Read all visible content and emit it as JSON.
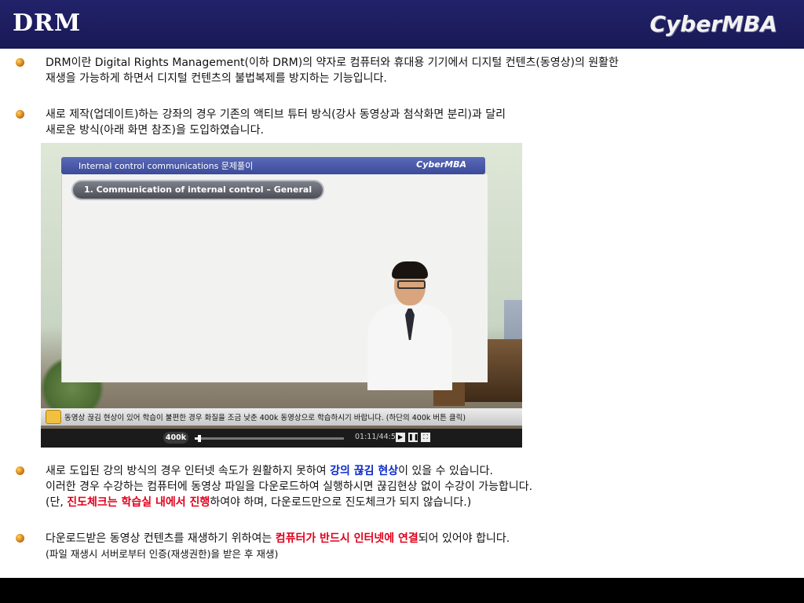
{
  "header": {
    "title": "DRM",
    "logo": "CyberMBA"
  },
  "bullets": [
    {
      "icon": "bullet-dot-icon",
      "line1": "DRM이란 Digital Rights Management(이하 DRM)의 약자로 컴퓨터와 휴대용 기기에서 디지털 컨텐츠(동영상)의 원활한",
      "line2": "재생을 가능하게 하면서 디지털 컨텐츠의 불법복제를 방지하는 기능입니다."
    },
    {
      "icon": "bullet-dot-icon",
      "line1": "새로 제작(업데이트)하는 강좌의 경우 기존의 액티브 튜터 방식(강사 동영상과 첨삭화면 분리)과 달리",
      "line2": "새로운 방식(아래 화면 참조)을 도입하였습니다."
    },
    {
      "icon": "bullet-dot-icon",
      "line1_pre": "새로 도입된 강의 방식의 경우 인터넷 속도가 원활하지 못하여 ",
      "line1_em": "강의 끊김 현상",
      "line1_post": "이 있을 수 있습니다.",
      "line2": "이러한 경우 수강하는 컴퓨터에 동영상 파일을 다운로드하여 실행하시면 끊김현상 없이 수강이 가능합니다.",
      "line3_pre": "(단, ",
      "line3_em": "진도체크는 학습실 내에서 진행",
      "line3_post": "하여야 하며, 다운로드만으로 진도체크가 되지 않습니다.)"
    },
    {
      "icon": "bullet-dot-icon",
      "line1_pre": "다운로드받은 동영상 컨텐츠를 재생하기 위하여는 ",
      "line1_em": "컴퓨터가 반드시 인터넷에 연결",
      "line1_post": "되어 있어야 합니다.",
      "line2": "(파일 재생시 서버로부터 인증(재생권한)을 받은 후 재생)"
    }
  ],
  "video": {
    "header_title": "Internal control communications 문제풀이",
    "header_logo": "CyberMBA",
    "chapter": "1. Communication of internal control – General",
    "notice": "동영상 끊김 현상이 있어 학습이 불편한 경우 화질을 조금 낮춘 400k 동영상으로 학습하시기 바랍니다. (하단의 400k 버튼 클릭)",
    "bitrate_button": "400k",
    "time": "01:11/44:53",
    "progress": 0.03,
    "play_icon": "▶",
    "pause_icon": "❚❚",
    "fullscreen_icon": "⛶"
  },
  "colors": {
    "header_bg": "#1d1d5e",
    "emphasis_blue": "#0b2ac8",
    "emphasis_red": "#e0001b"
  }
}
